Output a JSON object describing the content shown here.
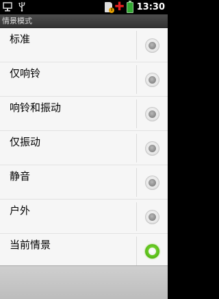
{
  "status_bar": {
    "time": "13:30",
    "icons": [
      "monitor-icon",
      "usb-icon",
      "sim-warning-icon",
      "red-cross-icon",
      "battery-icon"
    ]
  },
  "title_bar": {
    "title": "情景模式"
  },
  "profiles": [
    {
      "label": "标准",
      "selected": false
    },
    {
      "label": "仅响铃",
      "selected": false
    },
    {
      "label": "响铃和振动",
      "selected": false
    },
    {
      "label": "仅振动",
      "selected": false
    },
    {
      "label": "静音",
      "selected": false
    },
    {
      "label": "户外",
      "selected": false
    },
    {
      "label": "当前情景",
      "selected": true
    }
  ],
  "colors": {
    "selected_radio": "#5bbf1a",
    "list_background": "#f6f6f6",
    "title_bar": "#3f3f3f"
  }
}
